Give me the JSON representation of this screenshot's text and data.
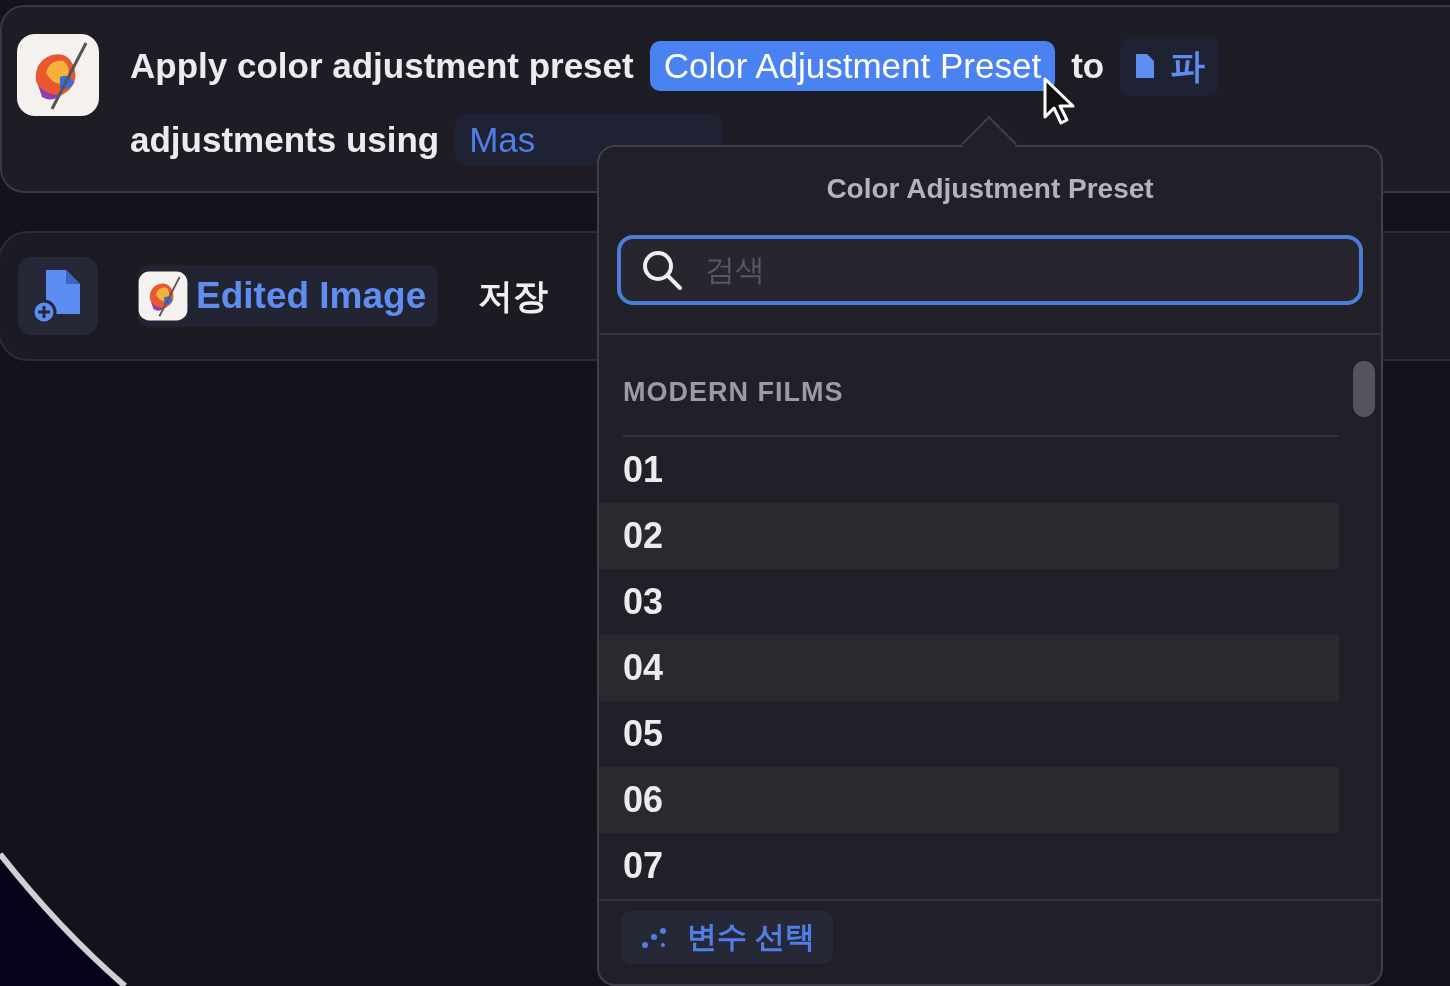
{
  "action": {
    "text_1": "Apply color adjustment preset",
    "param": {
      "label": "Color Adjustment Preset",
      "selected": true
    },
    "text_2": "to",
    "file_token": "파",
    "text_3": "adjustments using",
    "mask_token": "Mas"
  },
  "save_action": {
    "variable": "Edited Image",
    "text": "저장"
  },
  "popover": {
    "title": "Color Adjustment Preset",
    "search": {
      "placeholder": "검색"
    },
    "section": "MODERN FILMS",
    "items": [
      {
        "label": "01"
      },
      {
        "label": "02"
      },
      {
        "label": "03"
      },
      {
        "label": "04"
      },
      {
        "label": "05"
      },
      {
        "label": "06"
      },
      {
        "label": "07"
      }
    ],
    "footer_button": "변수 선택"
  }
}
